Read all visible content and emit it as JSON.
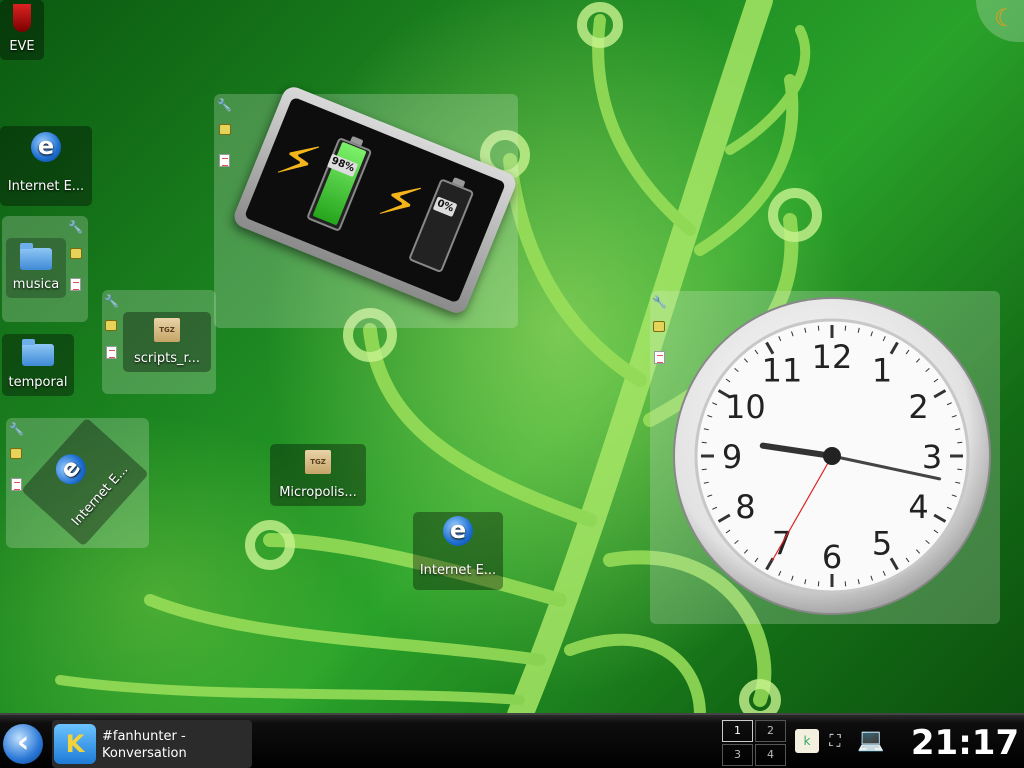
{
  "desktop": {
    "icons": [
      {
        "label": "EVE"
      },
      {
        "label": "Internet E..."
      },
      {
        "label": "musica"
      },
      {
        "label": "temporal"
      },
      {
        "label": "scripts_r..."
      },
      {
        "label": "Internet E..."
      },
      {
        "label": "Micropolis..."
      },
      {
        "label": "Internet E..."
      }
    ],
    "tgz_text": "TGZ"
  },
  "battery": {
    "battery1_percent": "98%",
    "battery2_percent": "0%",
    "battery1_level": 0.98,
    "battery2_level": 0.0
  },
  "analog_clock": {
    "numerals": [
      "12",
      "1",
      "2",
      "3",
      "4",
      "5",
      "6",
      "7",
      "8",
      "9",
      "10",
      "11"
    ],
    "hour": 9,
    "minute": 17
  },
  "taskbar": {
    "task": {
      "title_line1": "#fanhunter -",
      "title_line2": "Konversation"
    },
    "pager": [
      "1",
      "2",
      "3",
      "4"
    ],
    "active_desktop": "1",
    "clock": "21:17"
  },
  "colors": {
    "accent": "#f3b51a",
    "battery_green": "#25a51c"
  }
}
